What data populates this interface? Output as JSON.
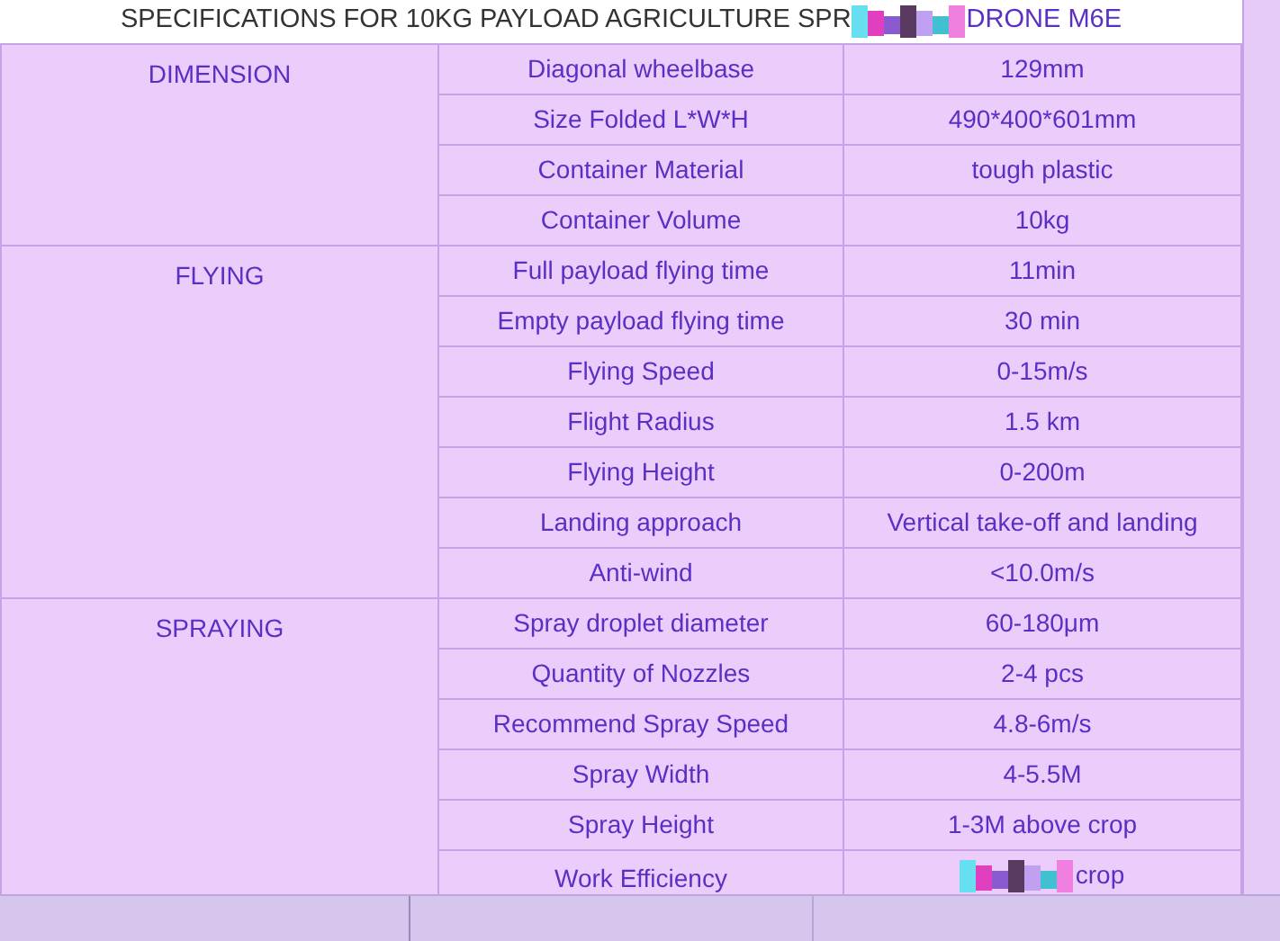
{
  "title": {
    "before_glitch": "SPECIFICATIONS FOR 10KG PAYLOAD AGRICULTURE SPR",
    "after_glitch": "DRONE M6E"
  },
  "groups": [
    {
      "name": "DIMENSION",
      "rows": [
        {
          "parameter": "Diagonal wheelbase",
          "value": "129mm"
        },
        {
          "parameter": "Size Folded L*W*H",
          "value": "490*400*601mm"
        },
        {
          "parameter": "Container Material",
          "value": "tough plastic"
        },
        {
          "parameter": "Container Volume",
          "value": "10kg"
        }
      ]
    },
    {
      "name": "FLYING",
      "rows": [
        {
          "parameter": "Full payload flying time",
          "value": "11min"
        },
        {
          "parameter": "Empty payload flying time",
          "value": "30 min"
        },
        {
          "parameter": "Flying Speed",
          "value": "0-15m/s"
        },
        {
          "parameter": "Flight Radius",
          "value": "1.5 km"
        },
        {
          "parameter": "Flying Height",
          "value": "0-200m"
        },
        {
          "parameter": "Landing approach",
          "value": "Vertical take-off and landing"
        },
        {
          "parameter": "Anti-wind",
          "value": "<10.0m/s"
        }
      ]
    },
    {
      "name": "SPRAYING",
      "rows": [
        {
          "parameter": "Spray droplet diameter",
          "value": "60-180μm"
        },
        {
          "parameter": "Quantity of Nozzles",
          "value": "2-4 pcs"
        },
        {
          "parameter": "Recommend Spray Speed",
          "value": "4.8-6m/s"
        },
        {
          "parameter": "Spray Width",
          "value": "4-5.5M"
        },
        {
          "parameter": "Spray Height",
          "value": "1-3M above crop"
        },
        {
          "parameter": "Work Efficiency",
          "value": "crop"
        }
      ]
    }
  ]
}
